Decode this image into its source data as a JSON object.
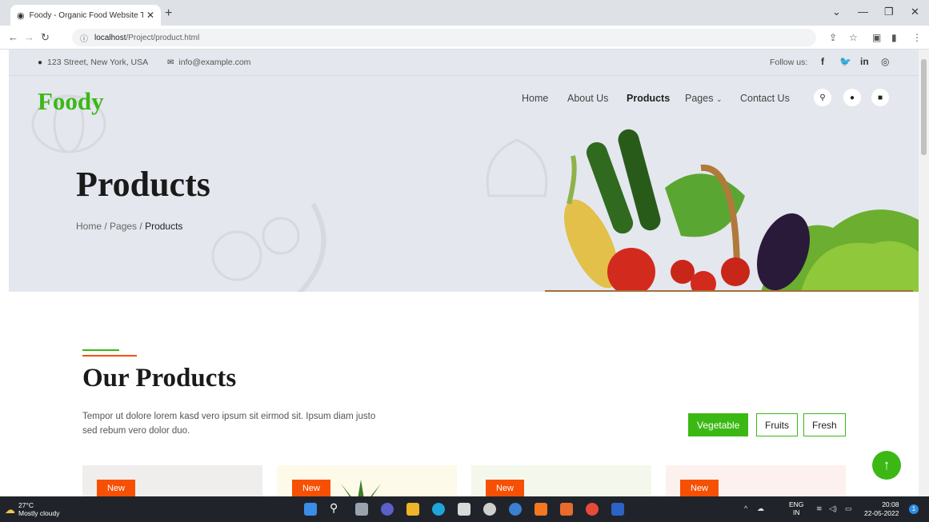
{
  "browser": {
    "tab_title": "Foody - Organic Food Website Te",
    "url_host": "localhost",
    "url_path": "/Project/product.html",
    "close_tab": "✕",
    "new_tab": "+"
  },
  "topbar": {
    "address": "123 Street, New York, USA",
    "email": "info@example.com",
    "follow_label": "Follow us:",
    "social": [
      "f",
      "t",
      "in",
      "ig"
    ]
  },
  "header": {
    "logo": "Foody",
    "nav": [
      "Home",
      "About Us",
      "Products",
      "Pages",
      "Contact Us"
    ],
    "active_nav": "Products"
  },
  "hero": {
    "title": "Products",
    "breadcrumb": [
      "Home",
      "Pages",
      "Products"
    ]
  },
  "section": {
    "title": "Our Products",
    "description": "Tempor ut dolore lorem kasd vero ipsum sit eirmod sit. Ipsum diam justo sed rebum vero dolor duo.",
    "filters": [
      "Vegetable",
      "Fruits",
      "Fresh"
    ],
    "active_filter": "Vegetable"
  },
  "cards": [
    {
      "badge": "New",
      "bg": "#f0eded"
    },
    {
      "badge": "New",
      "bg": "#fdfae9"
    },
    {
      "badge": "New",
      "bg": "#f4f8ec"
    },
    {
      "badge": "New",
      "bg": "#fcf1ee"
    }
  ],
  "taskbar": {
    "temperature": "27°C",
    "weather": "Mostly cloudy",
    "lang": "ENG",
    "region": "IN",
    "time": "20:08",
    "date": "22-05-2022",
    "notifications": "1"
  },
  "colors": {
    "brand_green": "#3cb815",
    "accent_orange": "#f65005"
  }
}
